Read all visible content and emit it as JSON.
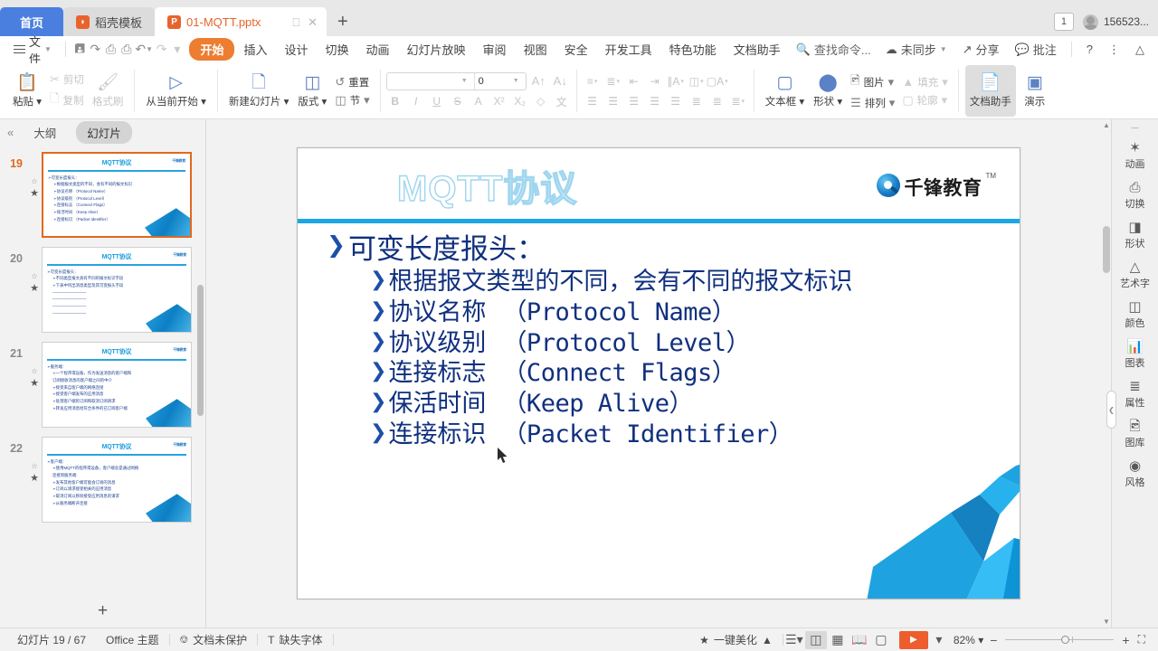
{
  "tabbar": {
    "home_tab": "首页",
    "template_tab": "稻壳模板",
    "doc_tab": "01-MQTT.pptx",
    "new_tab": "+",
    "badge_count": "1",
    "user_name": "156523..."
  },
  "menubar": {
    "file": "文件",
    "items": [
      "开始",
      "插入",
      "设计",
      "切换",
      "动画",
      "幻灯片放映",
      "审阅",
      "视图",
      "安全",
      "开发工具",
      "特色功能",
      "文档助手"
    ],
    "active_item": "开始",
    "search": "查找命令...",
    "sync": "未同步",
    "share": "分享",
    "comment": "批注",
    "help": "?"
  },
  "ribbon": {
    "paste": "粘贴",
    "cut": "剪切",
    "copy": "复制",
    "format_painter": "格式刷",
    "start_from_current": "从当前开始",
    "new_slide": "新建幻灯片",
    "layout": "版式",
    "reset": "重置",
    "section": "节",
    "font_name": "",
    "font_size": "0",
    "textbox": "文本框",
    "shape": "形状",
    "picture": "图片",
    "arrange": "排列",
    "fill": "填充",
    "outline": "轮廓",
    "doc_assistant": "文档助手",
    "present": "演示"
  },
  "left_pane": {
    "outline_tab": "大纲",
    "slides_tab": "幻灯片",
    "active_tab": "幻灯片",
    "add_slide": "+",
    "thumbnails": [
      {
        "number": "19",
        "title": "MQTT协议",
        "logo": "千锋教育",
        "selected": true,
        "lines": [
          {
            "indent": 0,
            "text": "➢可变长度报头："
          },
          {
            "indent": 1,
            "text": "➢根据报文类型的不同，会有不同的报文标识"
          },
          {
            "indent": 1,
            "text": "➢协议名称 （Protocol Name）"
          },
          {
            "indent": 1,
            "text": "➢协议级别 （Protocol Level）"
          },
          {
            "indent": 1,
            "text": "➢连接标志 （Connect Flags）"
          },
          {
            "indent": 1,
            "text": "➢保活时间 （Keep Alive）"
          },
          {
            "indent": 1,
            "text": "➢连接标识 （Packet Identifier）"
          }
        ]
      },
      {
        "number": "20",
        "title": "MQTT协议",
        "logo": "千锋教育",
        "selected": false,
        "lines": [
          {
            "indent": 0,
            "text": "➢可变长度报头："
          },
          {
            "indent": 1,
            "text": "➢不同类型报文具有不同的报文标识字段"
          },
          {
            "indent": 1,
            "text": "➢下表中列出消息类型及其可变报头字段"
          },
          {
            "indent": 1,
            "text": "────────────"
          },
          {
            "indent": 1,
            "text": "────────────"
          },
          {
            "indent": 1,
            "text": "────────────"
          },
          {
            "indent": 1,
            "text": "────────────"
          }
        ]
      },
      {
        "number": "21",
        "title": "MQTT协议",
        "logo": "千锋教育",
        "selected": false,
        "lines": [
          {
            "indent": 0,
            "text": "➢服务端："
          },
          {
            "indent": 1,
            "text": "➢一个程序或设备，作为发送消息的客户端和"
          },
          {
            "indent": 1,
            "text": "订阅接收消息的客户端之间的中介"
          },
          {
            "indent": 1,
            "text": "➢接受来自客户端的网络连接"
          },
          {
            "indent": 1,
            "text": "➢接受客户端发布的应用消息"
          },
          {
            "indent": 1,
            "text": "➢处理客户端的订阅和取消订阅请求"
          },
          {
            "indent": 1,
            "text": "➢转发应用消息给符合条件的已订阅客户端"
          }
        ]
      },
      {
        "number": "22",
        "title": "MQTT协议",
        "logo": "千锋教育",
        "selected": false,
        "lines": [
          {
            "indent": 0,
            "text": "➢客户端："
          },
          {
            "indent": 1,
            "text": "➢使用MQTT的程序或设备，客户端总是通过网络"
          },
          {
            "indent": 1,
            "text": "连接到服务端"
          },
          {
            "indent": 1,
            "text": "➢发布其他客户端可能会订阅的消息"
          },
          {
            "indent": 1,
            "text": "➢订阅以请求接受相关的应用消息"
          },
          {
            "indent": 1,
            "text": "➢取消订阅以移除接受应用消息的请求"
          },
          {
            "indent": 1,
            "text": "➢从服务端断开连接"
          }
        ]
      }
    ]
  },
  "slide": {
    "title": "MQTT协议",
    "logo_text": "千锋教育",
    "logo_tm": "TM",
    "accent_color": "#1ba6e4",
    "text_color": "#10307f",
    "bullets": [
      {
        "level": 1,
        "cn": "可变长度报头：",
        "en": ""
      },
      {
        "level": 2,
        "cn": "根据报文类型的不同，会有不同的报文标识",
        "en": ""
      },
      {
        "level": 2,
        "cn": "协议名称",
        "en": "（Protocol Name）"
      },
      {
        "level": 2,
        "cn": "协议级别",
        "en": "（Protocol Level）"
      },
      {
        "level": 2,
        "cn": "连接标志",
        "en": "（Connect Flags）"
      },
      {
        "level": 2,
        "cn": "保活时间",
        "en": "（Keep Alive）"
      },
      {
        "level": 2,
        "cn": "连接标识",
        "en": "（Packet Identifier）"
      }
    ]
  },
  "right_dock": {
    "items": [
      {
        "label": "动画",
        "icon": "animation-icon"
      },
      {
        "label": "切换",
        "icon": "transition-icon"
      },
      {
        "label": "形状",
        "icon": "shape-icon"
      },
      {
        "label": "艺术字",
        "icon": "wordart-icon"
      },
      {
        "label": "颜色",
        "icon": "color-icon"
      },
      {
        "label": "图表",
        "icon": "chart-icon"
      },
      {
        "label": "属性",
        "icon": "properties-icon"
      },
      {
        "label": "图库",
        "icon": "gallery-icon"
      },
      {
        "label": "风格",
        "icon": "style-icon"
      }
    ]
  },
  "status": {
    "slide_counter": "幻灯片 19 / 67",
    "theme": "Office 主题",
    "protection": "文档未保护",
    "missing_font": "缺失字体",
    "beautify": "一键美化",
    "zoom": "82%",
    "zoom_out": "−",
    "zoom_in": "+"
  }
}
